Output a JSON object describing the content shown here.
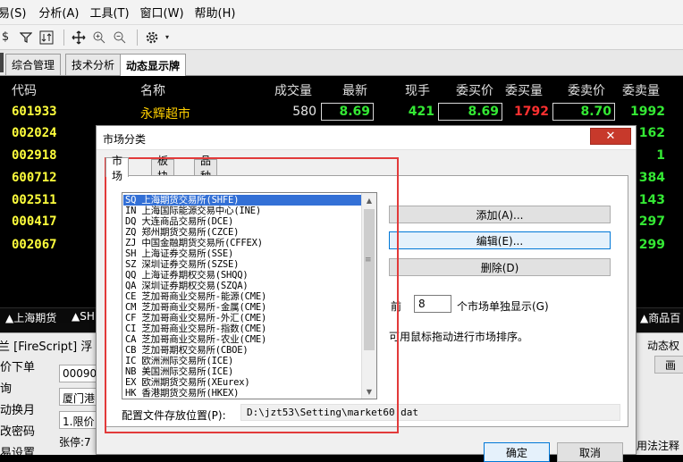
{
  "menubar": {
    "items": [
      "易(S)",
      "分析(A)",
      "工具(T)",
      "窗口(W)",
      "帮助(H)"
    ]
  },
  "toolbar": {
    "icons": [
      "dollar-icon",
      "filter-icon",
      "sort-icon",
      "move-icon",
      "zoom-in-icon",
      "zoom-out-icon",
      "gear-icon"
    ]
  },
  "tabs": [
    "综合管理",
    "技术分析",
    "动态显示牌"
  ],
  "quote": {
    "headers": {
      "code": "代码",
      "name": "名称",
      "volume": "成交量",
      "last": "最新",
      "hand": "现手",
      "bid": "委买价",
      "bidvol": "委买量",
      "ask": "委卖价",
      "askvol": "委卖量"
    },
    "rows": [
      {
        "code": "601933",
        "name": "永辉超市",
        "volume": "580",
        "last": "8.69",
        "hand": "421",
        "bid": "8.69",
        "bidvol": "1792",
        "ask": "8.70",
        "askvol": "1992"
      },
      {
        "code": "002024",
        "askvol": "162"
      },
      {
        "code": "002918",
        "askvol": "1"
      },
      {
        "code": "600712",
        "askvol": "384"
      },
      {
        "code": "002511",
        "askvol": "143"
      },
      {
        "code": "000417",
        "askvol": "297"
      },
      {
        "code": "002067",
        "askvol": "299"
      }
    ]
  },
  "bottom_tabs": {
    "left": "▲上海期货",
    "mid": "▲SH",
    "right": "▲商品百"
  },
  "lower_panel": {
    "title": "兰 [FireScript]  浮",
    "left_items": [
      "价下单",
      "询",
      "动换月",
      "改密码",
      "易设置"
    ],
    "fields": [
      "000905",
      "厦门港",
      "1.限价"
    ],
    "limit_label": "张停:7",
    "right_title": "动态权",
    "right_btn": "画",
    "right_bottom": "用法注释"
  },
  "dialog": {
    "title": "市场分类",
    "close_glyph": "✕",
    "tabs": [
      "市场",
      "板块",
      "品种"
    ],
    "markets": [
      "SQ  上海期货交易所(SHFE)",
      "IN  上海国际能源交易中心(INE)",
      "DQ  大连商品交易所(DCE)",
      "ZQ  郑州期货交易所(CZCE)",
      "ZJ  中国金融期货交易所(CFFEX)",
      "SH  上海证券交易所(SSE)",
      "SZ  深圳证券交易所(SZSE)",
      "QQ  上海证券期权交易(SHQQ)",
      "QA  深圳证券期权交易(SZQA)",
      "CE  芝加哥商业交易所-能源(CME)",
      "CM  芝加哥商业交易所-金属(CME)",
      "CF  芝加哥商业交易所-外汇(CME)",
      "CI  芝加哥商业交易所-指数(CME)",
      "CA  芝加哥商业交易所-农业(CME)",
      "CB  芝加哥期权交易所(CBOE)",
      "IC  欧洲洲际交易所(ICE)",
      "NB  美国洲际交易所(ICE)",
      "EX  欧洲期货交易所(XEurex)",
      "HK  香港期货交易所(HKEX)"
    ],
    "buttons": {
      "add": "添加(A)...",
      "edit": "编辑(E)...",
      "delete": "删除(D)",
      "ok": "确定",
      "cancel": "取消"
    },
    "front_label": "前",
    "front_value": "8",
    "front_suffix": "个市场单独显示(G)",
    "drag_hint": "可用鼠标拖动进行市场排序。",
    "path_label": "配置文件存放位置(P):",
    "path_value": "D:\\jzt53\\Setting\\market60.dat"
  }
}
